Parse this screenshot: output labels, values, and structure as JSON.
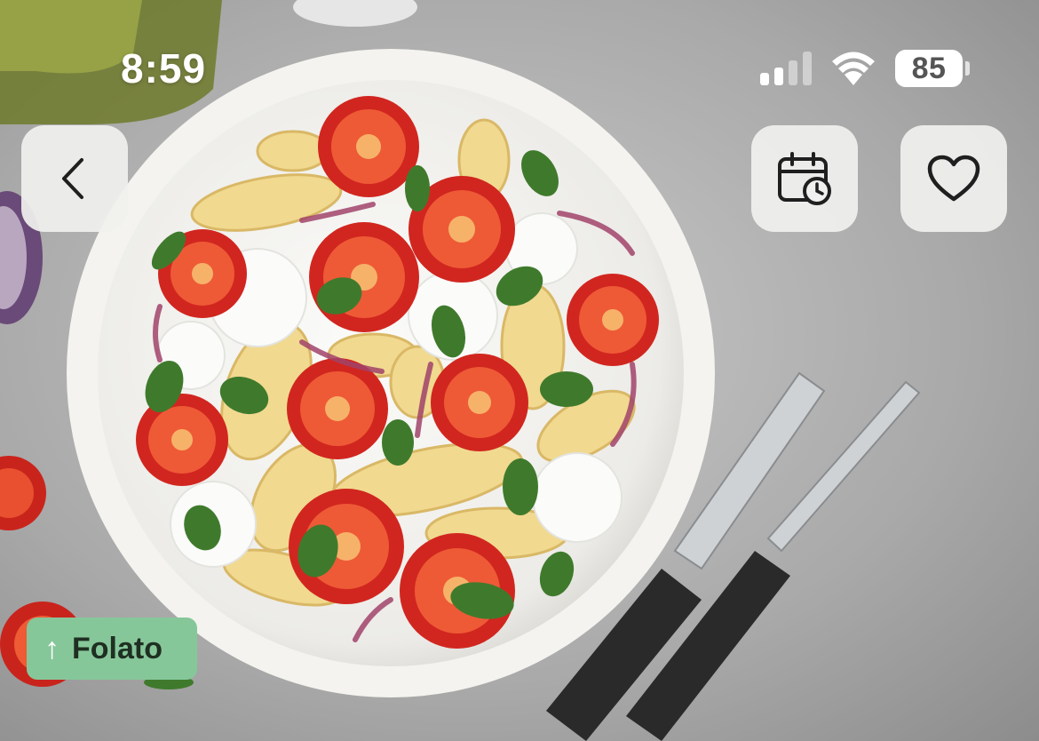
{
  "status_bar": {
    "time": "8:59",
    "battery_percent": "85",
    "signal_bars_active": 2,
    "signal_bars_total": 4
  },
  "hero": {
    "image_icon": "pasta-salad-photo"
  },
  "buttons": {
    "back_icon": "chevron-left-icon",
    "calendar_icon": "calendar-clock-icon",
    "favorite_icon": "heart-icon"
  },
  "badge": {
    "arrow": "↑",
    "label": "Folato",
    "color": "#86c79a"
  },
  "colors": {
    "button_bg": "#f0f0ee",
    "icon": "#1f1f1f",
    "badge_text": "#1f2f22"
  }
}
